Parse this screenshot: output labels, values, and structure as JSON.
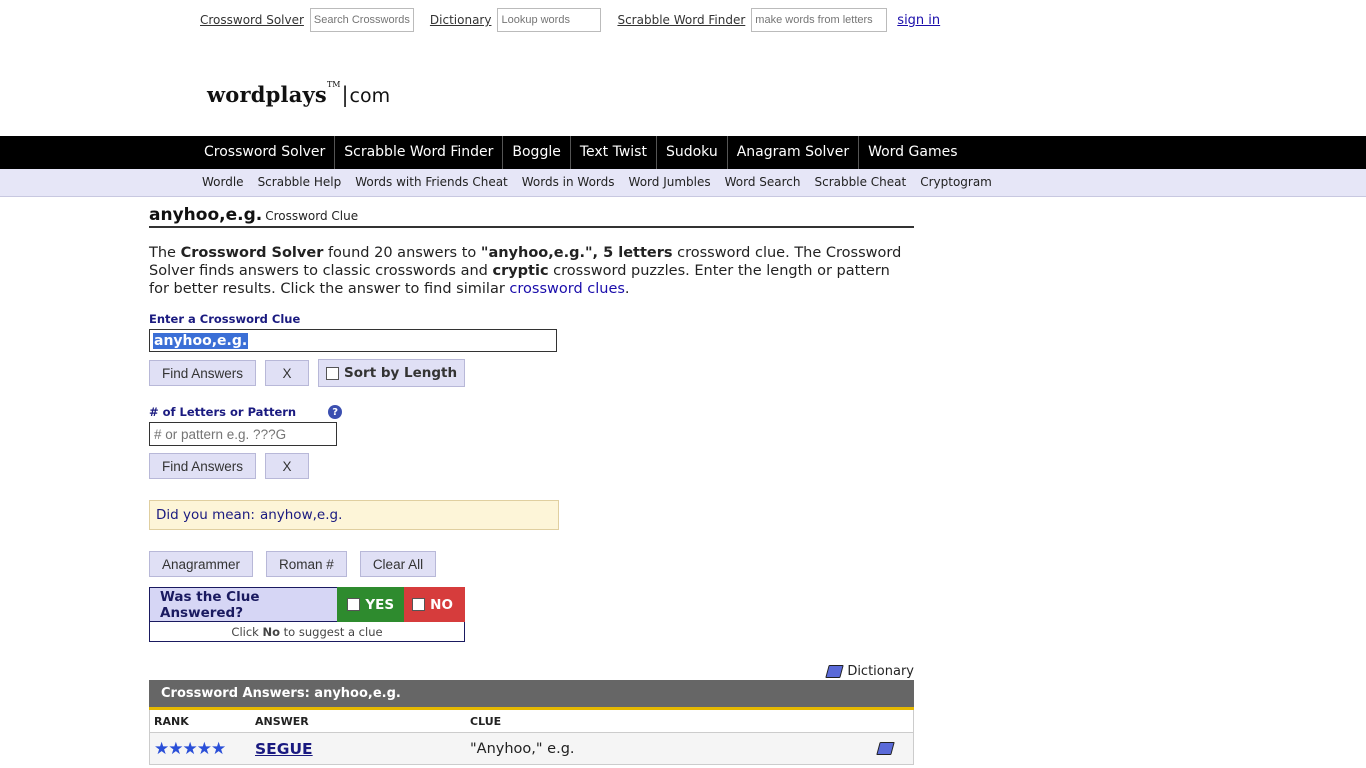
{
  "topbar": {
    "crossword_link": "Crossword Solver",
    "crossword_placeholder": "Search Crosswords",
    "dictionary_link": "Dictionary",
    "dictionary_placeholder": "Lookup words",
    "scrabble_link": "Scrabble Word Finder",
    "scrabble_placeholder": "make words from letters",
    "sign_in": "sign in"
  },
  "logo": {
    "name": "wordplays",
    "tm": "TM",
    "sep": "|",
    "tld": "com"
  },
  "main_nav": [
    "Crossword Solver",
    "Scrabble Word Finder",
    "Boggle",
    "Text Twist",
    "Sudoku",
    "Anagram Solver",
    "Word Games"
  ],
  "sub_nav": [
    "Wordle",
    "Scrabble Help",
    "Words with Friends Cheat",
    "Words in Words",
    "Word Jumbles",
    "Word Search",
    "Scrabble Cheat",
    "Cryptogram"
  ],
  "page": {
    "title": "anyhoo,e.g.",
    "subtitle": "Crossword Clue",
    "intro": {
      "p1": "The ",
      "b1": "Crossword Solver",
      "p2": " found 20 answers to ",
      "b2": "\"anyhoo,e.g.\", 5 letters",
      "p3": " crossword clue. The Crossword Solver finds answers to classic crosswords and ",
      "b3": "cryptic",
      "p4": " crossword puzzles. Enter the length or pattern for better results. Click the answer to find similar ",
      "link": "crossword clues",
      "p5": "."
    }
  },
  "clue_form": {
    "label": "Enter a Crossword Clue",
    "value": "anyhoo,e.g.",
    "find_label": "Find Answers",
    "clear_label": "X",
    "sort_label": "Sort by Length"
  },
  "pattern_form": {
    "label": "# of Letters or Pattern",
    "help": "?",
    "placeholder": "# or pattern e.g. ???G",
    "find_label": "Find Answers",
    "clear_label": "X"
  },
  "did_you_mean": {
    "label": "Did you mean:",
    "suggestion": "anyhow,e.g."
  },
  "tools": [
    "Anagrammer",
    "Roman #",
    "Clear All"
  ],
  "answered": {
    "question": "Was the Clue Answered?",
    "yes": "YES",
    "no": "NO",
    "hint_pre": "Click ",
    "hint_bold": "No",
    "hint_post": " to suggest a clue"
  },
  "dictionary_link": "Dictionary",
  "results": {
    "header": "Crossword Answers: anyhoo,e.g.",
    "columns": [
      "RANK",
      "ANSWER",
      "CLUE"
    ],
    "rows": [
      {
        "stars": "★★★★★",
        "rank": 5,
        "answer": "SEGUE",
        "clue": "\"Anyhoo,\" e.g."
      }
    ]
  },
  "colors": {
    "nav_bg": "#000000",
    "subnav_bg": "#e6e6f7",
    "yes": "#2e8b2e",
    "no": "#d63c3c",
    "results_accent": "#e5b800"
  }
}
